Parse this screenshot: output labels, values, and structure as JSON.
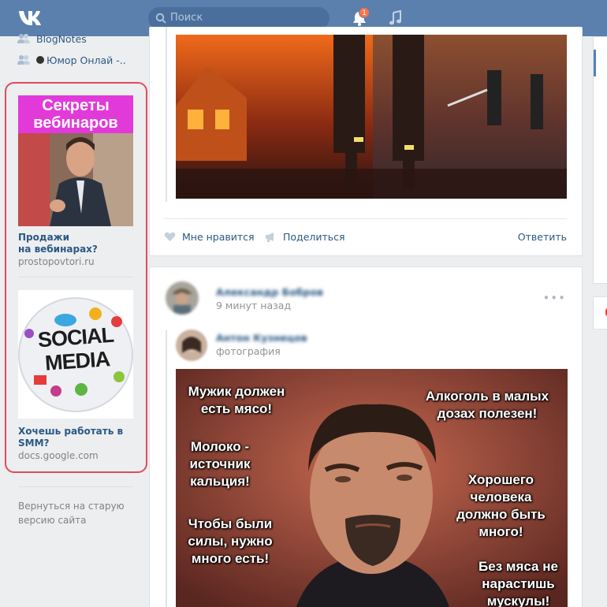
{
  "header": {
    "search_placeholder": "Поиск",
    "notifications_count": "1"
  },
  "sidebar": {
    "items": [
      {
        "label": "BlogNotes"
      },
      {
        "label": "Юмор Онлай -.."
      }
    ],
    "ads": [
      {
        "banner_text": "Секреты вебинаров",
        "title": "Продажи\nна вебинарах?",
        "domain": "prostopovtori.ru"
      },
      {
        "banner_text": "SOCIAL MEDIA",
        "title": "Хочешь работать в\nSMM?",
        "domain": "docs.google.com"
      }
    ],
    "old_version_link": "Вернуться на старую версию сайта"
  },
  "feed": {
    "post1": {
      "like_label": "Мне нравится",
      "share_label": "Поделиться",
      "reply_label": "Ответить"
    },
    "post2": {
      "author": "Александр Бобров",
      "time": "9 минут назад",
      "repost_author": "Антон Кузнецов",
      "repost_type": "фотография",
      "meme_lines": [
        "Мужик должен\nесть мясо!",
        "Алкоголь в малых\nдозах полезен!",
        "Молоко -\nисточник\nкальция!",
        "Хорошего\nчеловека\nдолжно быть\nмного!",
        "Чтобы были\nсилы, нужно\nмного есть!",
        "Без мяса не\nнарастишь\nмускулы!"
      ]
    }
  },
  "colors": {
    "header": "#5b80ad",
    "link": "#2a5885",
    "highlight": "#e14a5e",
    "badge": "#ff7349"
  }
}
